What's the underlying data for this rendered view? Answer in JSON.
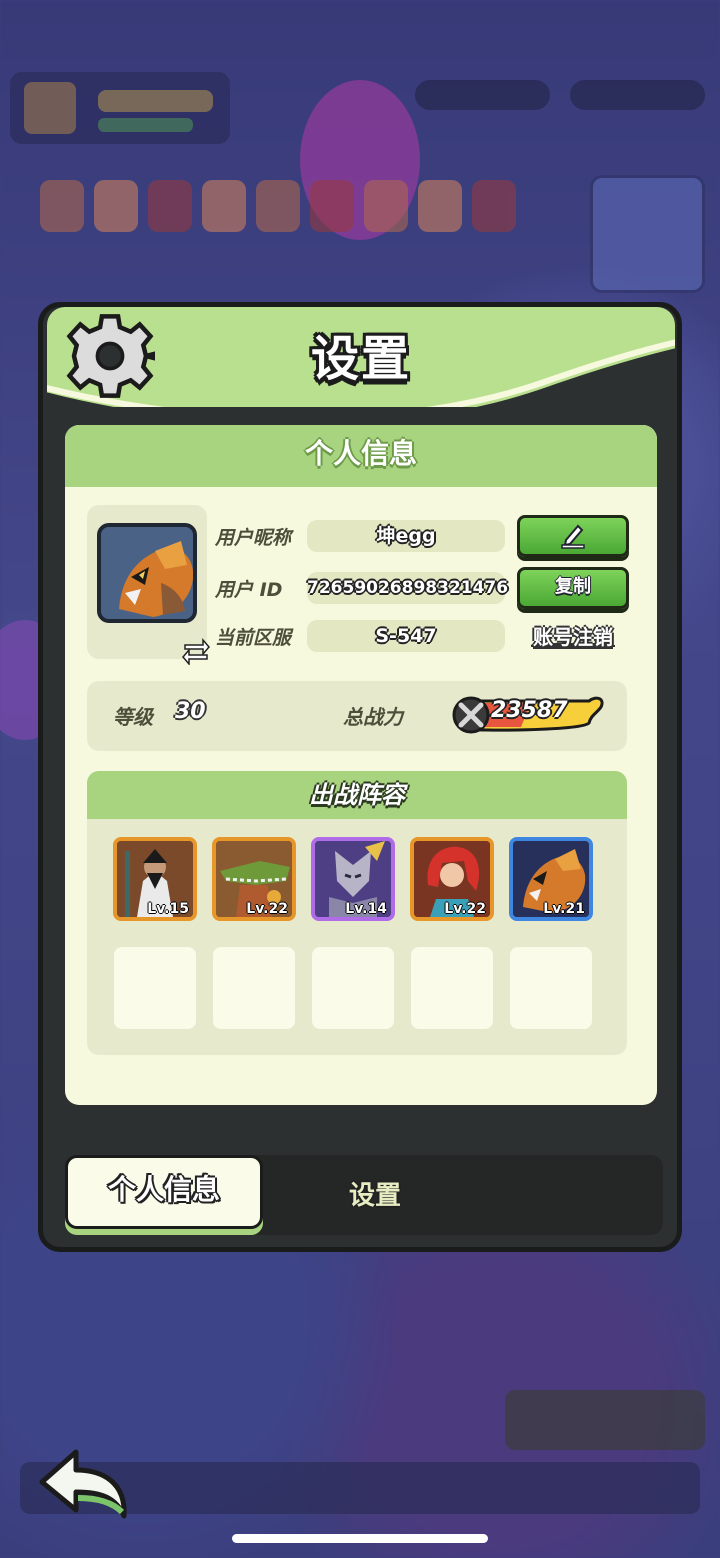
{
  "dialog": {
    "title": "设置"
  },
  "profile": {
    "section_title": "个人信息",
    "nickname_label": "用户昵称",
    "nickname_value": "坤egg",
    "id_label": "用户  ID",
    "id_value": "72659026898321476",
    "server_label": "当前区服",
    "server_value": "S-547",
    "copy_button_label": "复制",
    "delete_account_link": "账号注销",
    "level_label": "等级",
    "level_value": "30",
    "power_label": "总战力",
    "power_value": "23587"
  },
  "lineup": {
    "title": "出战阵容",
    "heroes": [
      {
        "level": "Lv.15",
        "frame": "orange"
      },
      {
        "level": "Lv.22",
        "frame": "orange"
      },
      {
        "level": "Lv.14",
        "frame": "purple"
      },
      {
        "level": "Lv.22",
        "frame": "orange"
      },
      {
        "level": "Lv.21",
        "frame": "blue"
      }
    ]
  },
  "tabs": {
    "active_label": "个人信息",
    "settings_label": "设置"
  },
  "colors": {
    "accent_green": "#a8d47f",
    "panel_bg": "#f7f9df",
    "button_green": "#4aa834"
  }
}
